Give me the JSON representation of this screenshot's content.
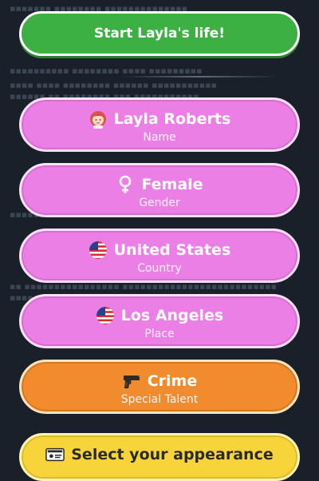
{
  "start_button": {
    "label": "Start Layla's life!"
  },
  "options": [
    {
      "title": "Layla Roberts",
      "subtitle": "Name",
      "icon": "red-haired-woman-icon"
    },
    {
      "title": "Female",
      "subtitle": "Gender",
      "icon": "female-sign-icon"
    },
    {
      "title": "United States",
      "subtitle": "Country",
      "icon": "us-flag-icon"
    },
    {
      "title": "Los Angeles",
      "subtitle": "Place",
      "icon": "us-flag-icon"
    },
    {
      "title": "Crime",
      "subtitle": "Special Talent",
      "icon": "pistol-icon"
    }
  ],
  "appearance_button": {
    "label": "Select your appearance",
    "icon": "id-card-icon"
  },
  "colors": {
    "start": "#3cb043",
    "option": "#ec7fe6",
    "talent": "#f08b2e",
    "appearance": "#f7d43a",
    "background": "#1a2029"
  }
}
